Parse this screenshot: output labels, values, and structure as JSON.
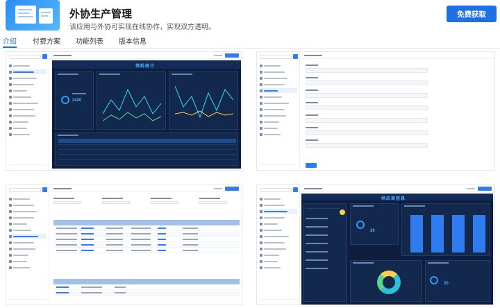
{
  "app": {
    "title": "外协生产管理",
    "description": "该应用与外协可实现在线协作，实现双方透明。",
    "get_button": "免费获取"
  },
  "tabs": [
    {
      "label": "介绍",
      "active": true
    },
    {
      "label": "付费方案",
      "active": false
    },
    {
      "label": "功能列表",
      "active": false
    },
    {
      "label": "版本信息",
      "active": false
    }
  ],
  "screens": [
    {
      "kind": "dashboard",
      "title": "领料统计",
      "kpi": "2420"
    },
    {
      "kind": "form"
    },
    {
      "kind": "table"
    },
    {
      "kind": "dashboard",
      "title": "供应商信息",
      "kpi": "20"
    }
  ],
  "colors": {
    "accent": "#1f6fe5",
    "dark_bg": "#0f1e3d"
  }
}
